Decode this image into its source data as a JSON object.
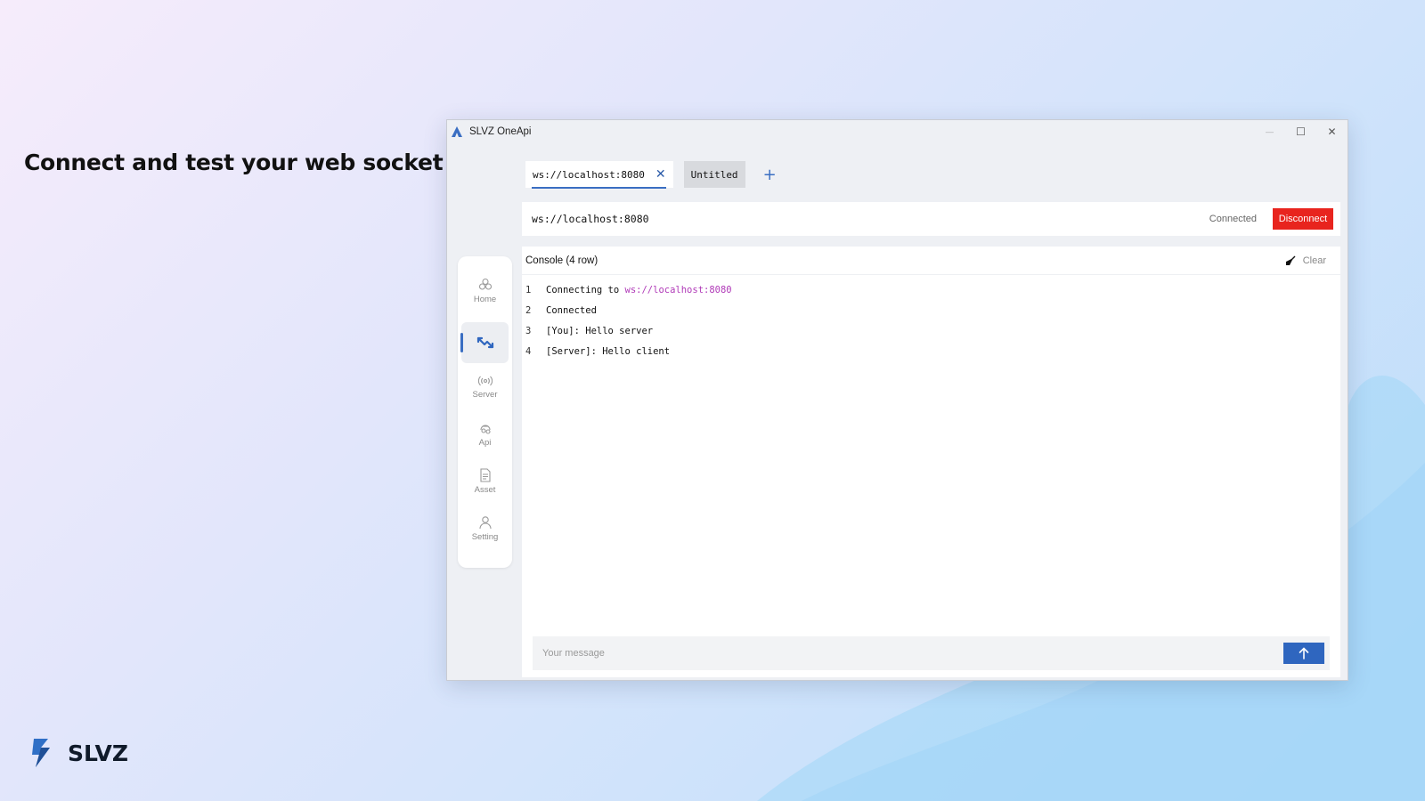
{
  "headline": "Connect and test your web socket",
  "brand": {
    "name": "SLVZ"
  },
  "window": {
    "title": "SLVZ OneApi",
    "controls": {
      "minimize": "—",
      "maximize": "☐",
      "close": "✕"
    }
  },
  "tabs": {
    "items": [
      {
        "label": "ws://localhost:8080",
        "active": true,
        "close": "✕"
      },
      {
        "label": "Untitled",
        "active": false
      }
    ],
    "add_label": "+"
  },
  "connection": {
    "url": "ws://localhost:8080",
    "status": "Connected",
    "disconnect_label": "Disconnect",
    "disconnect_color": "#e8241e"
  },
  "sidebar": {
    "items": [
      {
        "label": "Home",
        "icon": "home-icon",
        "active": false
      },
      {
        "label": "",
        "icon": "websocket-icon",
        "active": true
      },
      {
        "label": "Server",
        "icon": "server-icon",
        "active": false
      },
      {
        "label": "Api",
        "icon": "api-icon",
        "active": false
      },
      {
        "label": "Asset",
        "icon": "asset-icon",
        "active": false
      },
      {
        "label": "Setting",
        "icon": "setting-icon",
        "active": false
      }
    ]
  },
  "console": {
    "title": "Console (4 row)",
    "clear_label": "Clear",
    "lines": [
      {
        "num": "1",
        "text": "Connecting to ",
        "link": "ws://localhost:8080"
      },
      {
        "num": "2",
        "text": "Connected"
      },
      {
        "num": "3",
        "text": "[You]: Hello server"
      },
      {
        "num": "4",
        "text": "[Server]: Hello client"
      }
    ]
  },
  "message": {
    "placeholder": "Your message",
    "value": "",
    "send_icon": "arrow-up-icon"
  },
  "colors": {
    "accent": "#2f66bf",
    "link": "#b03ab8",
    "danger": "#e8241e"
  }
}
